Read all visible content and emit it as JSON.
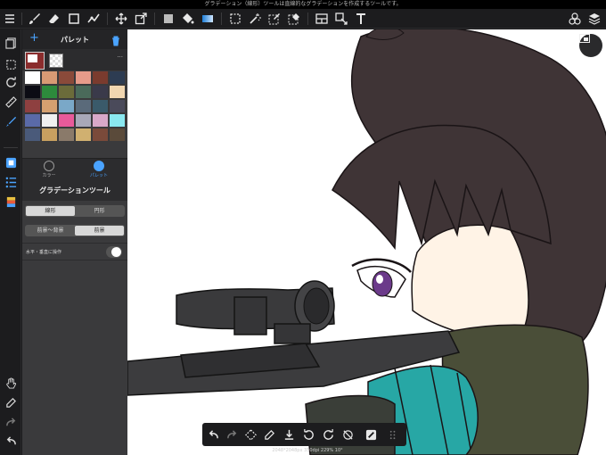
{
  "status_bar": {
    "message": "グラデーション（線形）ツールは直線的なグラデーションを作成するツールです。"
  },
  "toolbar": {
    "items": [
      "menu-icon",
      "brush-icon",
      "eraser-icon",
      "shape-icon",
      "stroke-edit-icon",
      "move-icon",
      "transform-icon",
      "fill-color-icon",
      "bucket-icon",
      "gradient-icon",
      "select-rect-icon",
      "magic-wand-icon",
      "select-pen-icon",
      "select-eraser-icon",
      "frame-divider-icon",
      "operation-icon",
      "text-icon",
      "material-icon",
      "layers-icon"
    ]
  },
  "panel": {
    "title": "パレット",
    "more": "···",
    "main_color": "#8b2d2d",
    "palette_colors": [
      "#ffffff",
      "#d89a74",
      "#8a4a3a",
      "#e79b8a",
      "#7a3b2e",
      "#2d3c52",
      "#0c0c14",
      "#2d8a3c",
      "#6b6b3a",
      "#4a6a5a",
      "#3a3a4a",
      "#f0d6b0",
      "#8e4040",
      "#d4a070",
      "#7aa8c8",
      "#5a6a7a",
      "#3a5a6a",
      "#4a4a5a",
      "#5a6aa8",
      "#f0f0f0",
      "#e85a9a",
      "#a8a8b8",
      "#d8a8c8",
      "#8ae8f0",
      "#4a5a7a",
      "#c8a060",
      "#8a7a6a",
      "#d0b070",
      "#7a4a3a",
      "#5a4a3a"
    ],
    "mode_tabs": [
      {
        "label": "カラー",
        "active": false
      },
      {
        "label": "パレット",
        "active": true
      }
    ],
    "tool_title": "グラデーションツール",
    "shape_options": [
      {
        "label": "線形",
        "active": true
      },
      {
        "label": "円形",
        "active": false
      }
    ],
    "color_options": [
      {
        "label": "前景〜背景",
        "active": false
      },
      {
        "label": "前景",
        "active": true
      }
    ],
    "toggle_label": "水平・垂直に操作"
  },
  "canvas": {
    "info": "2048*2048px 350dpi 229% 10°"
  }
}
